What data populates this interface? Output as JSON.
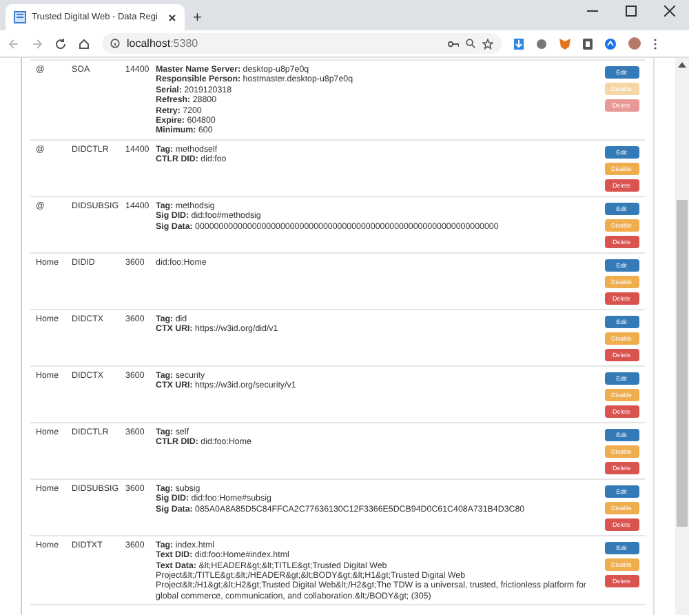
{
  "browser": {
    "tab_title": "Trusted Digital Web - Data Regi",
    "new_tab": "+",
    "address": "localhost",
    "port": ":5380"
  },
  "records": [
    {
      "name": "@",
      "type": "SOA",
      "ttl": "14400",
      "lines": [
        "**Master Name Server:** desktop-u8p7e0q",
        "**Responsible Person:** hostmaster.desktop-u8p7e0q",
        "**Serial:** 2019120318",
        "**Refresh:** 28800",
        "**Retry:** 7200",
        "**Expire:** 604800",
        "**Minimum:** 600"
      ],
      "buttons": [
        {
          "label": "Edit",
          "kind": "edit",
          "disabled": false
        },
        {
          "label": "Disable",
          "kind": "disable",
          "disabled": true
        },
        {
          "label": "Delete",
          "kind": "delete",
          "disabled": true
        }
      ]
    },
    {
      "name": "@",
      "type": "DIDCTLR",
      "ttl": "14400",
      "lines": [
        "**Tag:** methodself",
        "**CTLR DID:** did:foo"
      ],
      "buttons": [
        {
          "label": "Edit",
          "kind": "edit",
          "disabled": false
        },
        {
          "label": "Disable",
          "kind": "disable",
          "disabled": false
        },
        {
          "label": "Delete",
          "kind": "delete",
          "disabled": false
        }
      ]
    },
    {
      "name": "@",
      "type": "DIDSUBSIG",
      "ttl": "14400",
      "lines": [
        "**Tag:** methodsig",
        "**Sig DID:** did:foo#methodsig",
        "**Sig Data:** 0000000000000000000000000000000000000000000000000000000000000000"
      ],
      "buttons": [
        {
          "label": "Edit",
          "kind": "edit",
          "disabled": false
        },
        {
          "label": "Disable",
          "kind": "disable",
          "disabled": false
        },
        {
          "label": "Delete",
          "kind": "delete",
          "disabled": false
        }
      ]
    },
    {
      "name": "Home",
      "type": "DIDID",
      "ttl": "3600",
      "lines": [
        "did:foo:Home"
      ],
      "buttons": [
        {
          "label": "Edit",
          "kind": "edit",
          "disabled": false
        },
        {
          "label": "Disable",
          "kind": "disable",
          "disabled": false
        },
        {
          "label": "Delete",
          "kind": "delete",
          "disabled": false
        }
      ]
    },
    {
      "name": "Home",
      "type": "DIDCTX",
      "ttl": "3600",
      "lines": [
        "**Tag:** did",
        "**CTX URI:** https://w3id.org/did/v1"
      ],
      "buttons": [
        {
          "label": "Edit",
          "kind": "edit",
          "disabled": false
        },
        {
          "label": "Disable",
          "kind": "disable",
          "disabled": false
        },
        {
          "label": "Delete",
          "kind": "delete",
          "disabled": false
        }
      ]
    },
    {
      "name": "Home",
      "type": "DIDCTX",
      "ttl": "3600",
      "lines": [
        "**Tag:** security",
        "**CTX URI:** https://w3id.org/security/v1"
      ],
      "buttons": [
        {
          "label": "Edit",
          "kind": "edit",
          "disabled": false
        },
        {
          "label": "Disable",
          "kind": "disable",
          "disabled": false
        },
        {
          "label": "Delete",
          "kind": "delete",
          "disabled": false
        }
      ]
    },
    {
      "name": "Home",
      "type": "DIDCTLR",
      "ttl": "3600",
      "lines": [
        "**Tag:** self",
        "**CTLR DID:** did:foo:Home"
      ],
      "buttons": [
        {
          "label": "Edit",
          "kind": "edit",
          "disabled": false
        },
        {
          "label": "Disable",
          "kind": "disable",
          "disabled": false
        },
        {
          "label": "Delete",
          "kind": "delete",
          "disabled": false
        }
      ]
    },
    {
      "name": "Home",
      "type": "DIDSUBSIG",
      "ttl": "3600",
      "lines": [
        "**Tag:** subsig",
        "**Sig DID:** did:foo:Home#subsig",
        "**Sig Data:** 085A0A8A85D5C84FFCA2C77636130C12F3366E5DCB94D0C61C408A731B4D3C80"
      ],
      "buttons": [
        {
          "label": "Edit",
          "kind": "edit",
          "disabled": false
        },
        {
          "label": "Disable",
          "kind": "disable",
          "disabled": false
        },
        {
          "label": "Delete",
          "kind": "delete",
          "disabled": false
        }
      ]
    },
    {
      "name": "Home",
      "type": "DIDTXT",
      "ttl": "3600",
      "lines": [
        "**Tag:** index.html",
        "**Text DID:** did:foo:Home#index.html",
        "**Text Data:** &lt;HEADER&gt;&lt;TITLE&gt;Trusted Digital Web Project&lt;/TITLE&gt;&lt;/HEADER&gt;&lt;BODY&gt;&lt;H1&gt;Trusted Digital Web Project&lt;/H1&gt;&lt;H2&gt;Trusted Digital Web&lt;/H2&gt;The TDW is a universal, trusted, frictionless platform for global commerce, communication, and collaboration.&lt;/BODY&gt; (305)"
      ],
      "buttons": [
        {
          "label": "Edit",
          "kind": "edit",
          "disabled": false
        },
        {
          "label": "Disable",
          "kind": "disable",
          "disabled": false
        },
        {
          "label": "Delete",
          "kind": "delete",
          "disabled": false
        }
      ]
    }
  ]
}
